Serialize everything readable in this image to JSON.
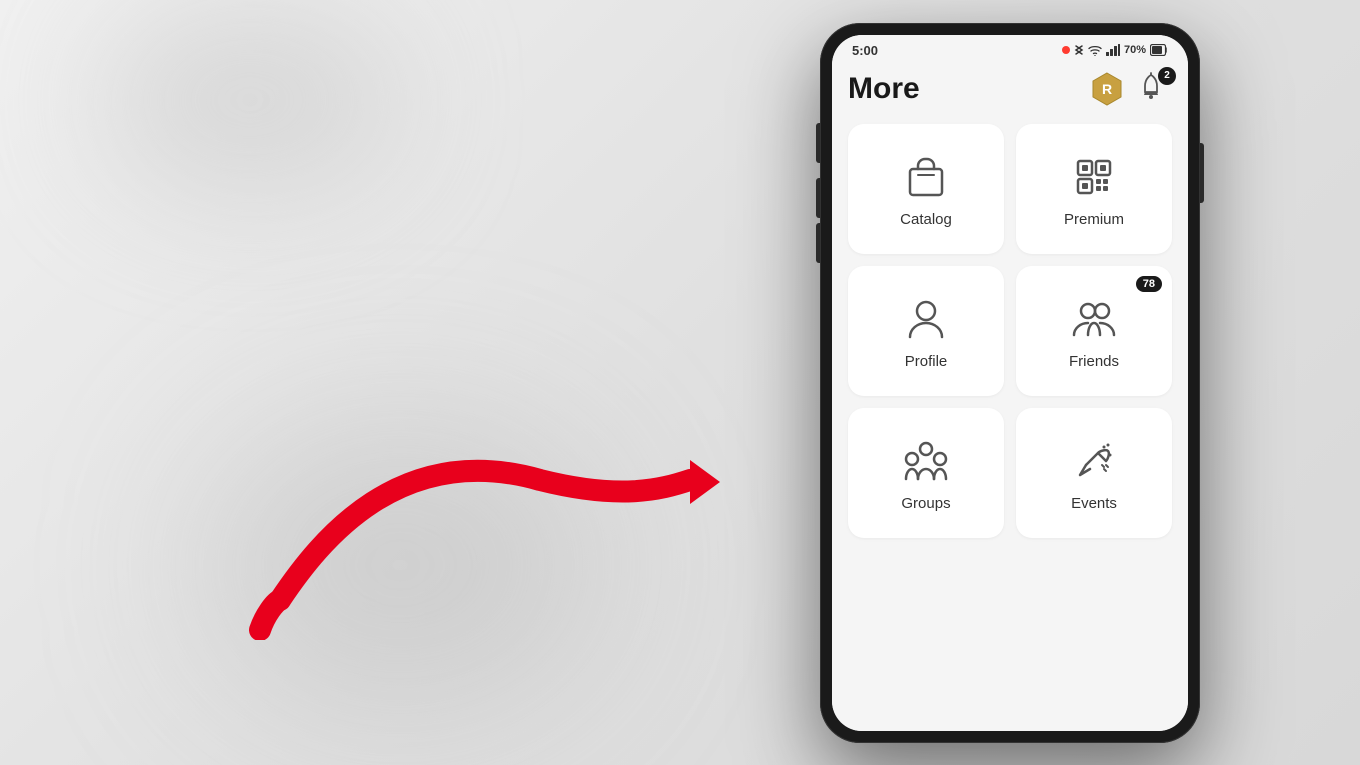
{
  "background": {
    "color": "#e8e8e8"
  },
  "status_bar": {
    "time": "5:00",
    "battery": "70%",
    "recording": true
  },
  "header": {
    "title": "More",
    "robux_label": "Robux",
    "notification_badge": "2"
  },
  "menu_items": [
    {
      "id": "catalog",
      "label": "Catalog",
      "icon": "shopping-bag-icon",
      "badge": null
    },
    {
      "id": "premium",
      "label": "Premium",
      "icon": "premium-icon",
      "badge": null
    },
    {
      "id": "profile",
      "label": "Profile",
      "icon": "person-icon",
      "badge": null
    },
    {
      "id": "friends",
      "label": "Friends",
      "icon": "friends-icon",
      "badge": "78"
    },
    {
      "id": "groups",
      "label": "Groups",
      "icon": "groups-icon",
      "badge": null
    },
    {
      "id": "events",
      "label": "Events",
      "icon": "events-icon",
      "badge": null
    }
  ],
  "arrow": {
    "color": "#e8001c",
    "direction": "right",
    "target": "profile"
  }
}
